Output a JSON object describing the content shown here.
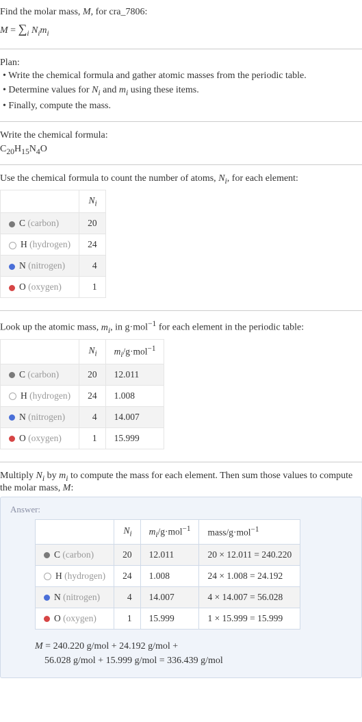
{
  "prompt": {
    "line1": "Find the molar mass, ",
    "var_M": "M",
    "line1b": ", for cra_7806:"
  },
  "plan": {
    "heading": "Plan:",
    "b1": "• Write the chemical formula and gather atomic masses from the periodic table.",
    "b2_pre": "• Determine values for ",
    "b2_mid": " and ",
    "b2_post": " using these items.",
    "b3": "• Finally, compute the mass."
  },
  "step1": {
    "heading": "Write the chemical formula:",
    "formula_C": "C",
    "sub_C": "20",
    "formula_H": "H",
    "sub_H": "15",
    "formula_N": "N",
    "sub_N": "4",
    "formula_O": "O"
  },
  "step2": {
    "heading_pre": "Use the chemical formula to count the number of atoms, ",
    "heading_post": ", for each element:"
  },
  "table1": {
    "col_Ni_html": "N<sub>i</sub>",
    "rows": [
      {
        "el": "C",
        "name": "(carbon)",
        "ni": "20"
      },
      {
        "el": "H",
        "name": "(hydrogen)",
        "ni": "24"
      },
      {
        "el": "N",
        "name": "(nitrogen)",
        "ni": "4"
      },
      {
        "el": "O",
        "name": "(oxygen)",
        "ni": "1"
      }
    ]
  },
  "step3": {
    "heading_pre": "Look up the atomic mass, ",
    "heading_mid": ", in g·mol",
    "heading_post": " for each element in the periodic table:"
  },
  "table2": {
    "rows": [
      {
        "el": "C",
        "name": "(carbon)",
        "ni": "20",
        "mi": "12.011"
      },
      {
        "el": "H",
        "name": "(hydrogen)",
        "ni": "24",
        "mi": "1.008"
      },
      {
        "el": "N",
        "name": "(nitrogen)",
        "ni": "4",
        "mi": "14.007"
      },
      {
        "el": "O",
        "name": "(oxygen)",
        "ni": "1",
        "mi": "15.999"
      }
    ]
  },
  "step4": {
    "heading_pre": "Multiply ",
    "heading_mid": " by ",
    "heading_mid2": " to compute the mass for each element. Then sum those values to compute the molar mass, ",
    "heading_post": ":"
  },
  "answer": {
    "label": "Answer:",
    "rows": [
      {
        "el": "C",
        "name": "(carbon)",
        "ni": "20",
        "mi": "12.011",
        "mass": "20 × 12.011 = 240.220"
      },
      {
        "el": "H",
        "name": "(hydrogen)",
        "ni": "24",
        "mi": "1.008",
        "mass": "24 × 1.008 = 24.192"
      },
      {
        "el": "N",
        "name": "(nitrogen)",
        "ni": "4",
        "mi": "14.007",
        "mass": "4 × 14.007 = 56.028"
      },
      {
        "el": "O",
        "name": "(oxygen)",
        "ni": "1",
        "mi": "15.999",
        "mass": "1 × 15.999 = 15.999"
      }
    ],
    "final_line1_pre": "M",
    "final_line1": " = 240.220 g/mol + 24.192 g/mol + ",
    "final_line2": "56.028 g/mol + 15.999 g/mol = 336.439 g/mol"
  },
  "symbols": {
    "Ni": "N",
    "Ni_sub": "i",
    "mi": "m",
    "mi_sub": "i",
    "M": "M",
    "neg1": "−1"
  },
  "headers": {
    "Ni": "N",
    "Ni_sub": "i",
    "mi_pre": "m",
    "mi_sub": "i",
    "mi_unit": "/g·mol",
    "mass": "mass/g·mol"
  }
}
